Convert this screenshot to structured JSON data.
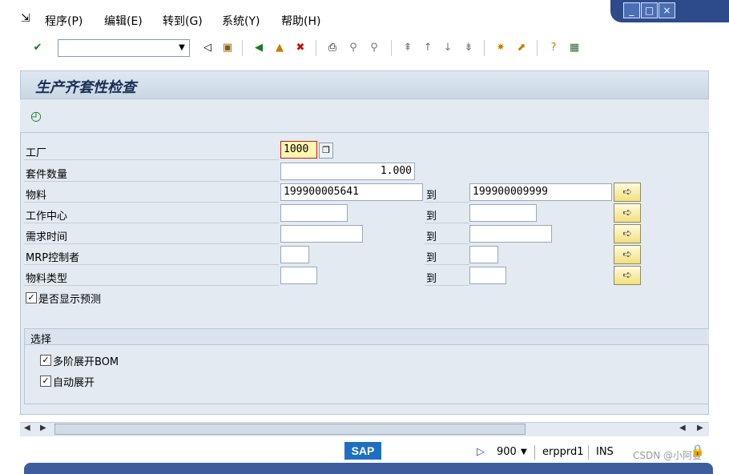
{
  "menu": {
    "icon": "exit-menu-icon",
    "items": [
      "程序(P)",
      "编辑(E)",
      "转到(G)",
      "系统(Y)",
      "帮助(H)"
    ]
  },
  "window_controls": {
    "minimize": "_",
    "maximize": "□",
    "close": "×"
  },
  "toolbar": {
    "command_field_value": ""
  },
  "screen": {
    "title": "生产齐套性检查",
    "execute_icon": "execute-clock-icon"
  },
  "form": {
    "plant": {
      "label": "工厂",
      "value": "1000"
    },
    "kit_qty": {
      "label": "套件数量",
      "value": "1.000"
    },
    "material": {
      "label": "物料",
      "from": "199900005641",
      "to_label": "到",
      "to": "199900009999"
    },
    "work_center": {
      "label": "工作中心",
      "from": "",
      "to_label": "到",
      "to": ""
    },
    "req_time": {
      "label": "需求时间",
      "from": "",
      "to_label": "到",
      "to": ""
    },
    "mrp_controller": {
      "label": "MRP控制者",
      "from": "",
      "to_label": "到",
      "to": ""
    },
    "material_type": {
      "label": "物料类型",
      "from": "",
      "to_label": "到",
      "to": ""
    },
    "show_forecast": {
      "label": "是否显示预测",
      "checked": true
    }
  },
  "selection": {
    "header": "选择",
    "multilevel_bom": {
      "label": "多阶展开BOM",
      "checked": true
    },
    "auto_expand": {
      "label": "自动展开",
      "checked": true
    }
  },
  "status": {
    "sap_logo": "SAP",
    "client": "900",
    "server": "erpprd1",
    "mode": "INS",
    "watermark": "CSDN @小阿曼"
  },
  "colors": {
    "accent": "#2d4a8a",
    "panel": "#e3eaf1",
    "required_field": "#fff7b0"
  }
}
